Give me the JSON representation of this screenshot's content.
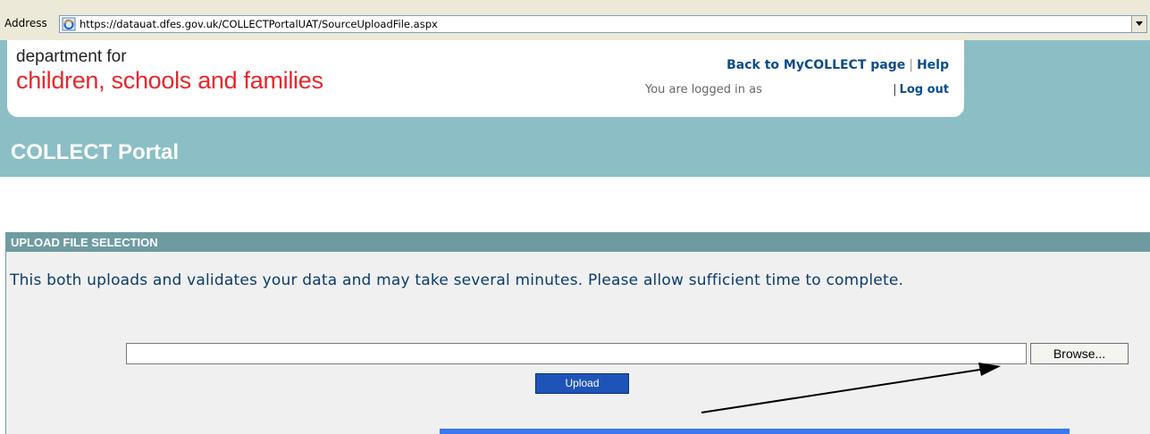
{
  "address_bar": {
    "label": "Address",
    "url": "https://datauat.dfes.gov.uk/COLLECTPortalUAT/SourceUploadFile.aspx"
  },
  "header": {
    "logo_line1": "department for",
    "logo_line2": "children, schools and families",
    "back_link": "Back to MyCOLLECT page",
    "help_link": "Help",
    "logged_in_text": "You are logged in as",
    "logout_link": "Log out",
    "portal_title": "COLLECT Portal"
  },
  "upload": {
    "section_title": "UPLOAD FILE SELECTION",
    "instructions": "This both uploads and validates your data and may take several minutes. Please allow sufficient time to complete.",
    "file_value": "",
    "browse_label": "Browse...",
    "upload_label": "Upload"
  },
  "colors": {
    "teal": "#8bbec5",
    "section_header": "#6e9ba1",
    "logo_red": "#e8262b",
    "link_blue": "#0b4c8a",
    "upload_button": "#1e54b8"
  }
}
